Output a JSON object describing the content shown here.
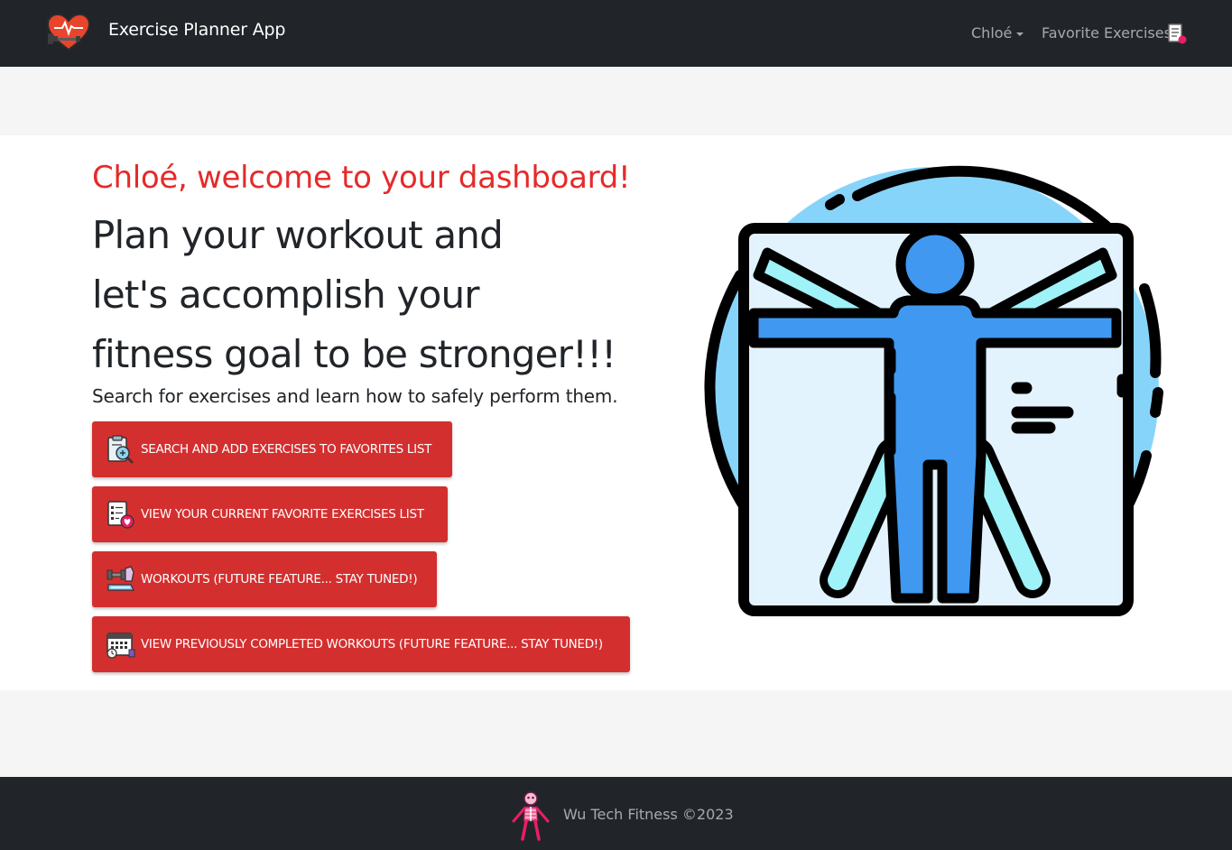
{
  "navbar": {
    "brand_icon": "heart-dumbbell-icon",
    "title": "Exercise Planner App",
    "user_menu_label": "Chloé",
    "favorites_label": "Favorite Exercises",
    "favorites_icon": "favorites-list-icon"
  },
  "hero": {
    "welcome": "Chloé, welcome to your dashboard!",
    "headline": [
      "Plan your workout and",
      "let's accomplish your",
      "fitness goal to be stronger!!!"
    ],
    "subline": "Search for exercises and learn how to safely perform them.",
    "buttons": [
      {
        "label": "SEARCH AND ADD EXERCISES TO FAVORITES LIST",
        "icon": "clipboard-search-icon"
      },
      {
        "label": "VIEW YOUR CURRENT FAVORITE EXERCISES LIST",
        "icon": "list-heart-icon"
      },
      {
        "label": "WORKOUTS (FUTURE FEATURE... STAY TUNED!)",
        "icon": "gym-equipment-icon"
      },
      {
        "label": "VIEW PREVIOUSLY COMPLETED WORKOUTS (FUTURE FEATURE... STAY TUNED!)",
        "icon": "calendar-clock-icon"
      }
    ],
    "illustration_icon": "vitruvian-man-icon"
  },
  "footer": {
    "logo_icon": "skeleton-icon",
    "text": "Wu Tech Fitness ©2023"
  },
  "colors": {
    "navbar_bg": "#212529",
    "accent_red": "#e52a2a",
    "button_red": "#d32f2f",
    "page_bg": "#f5f5f5"
  }
}
